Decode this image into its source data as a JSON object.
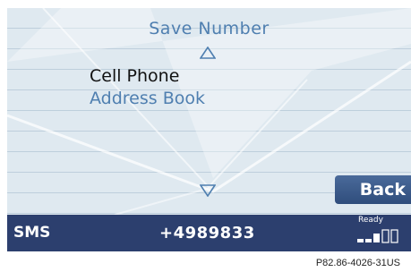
{
  "screen": {
    "title": "Save Number",
    "menu_items": [
      {
        "label": "Cell Phone",
        "selected": true
      },
      {
        "label": "Address Book",
        "selected": false
      }
    ],
    "back_label": "Back"
  },
  "status_bar": {
    "mode": "SMS",
    "phone_number": "+4989833",
    "status": "Ready",
    "signal_bars": 3,
    "signal_max": 5
  },
  "caption": "P82.86-4026-31US",
  "colors": {
    "accent_blue": "#4f7fb0",
    "status_bar": "#2c3f6e",
    "back_button": "#3a5a8a",
    "background": "#dfe9f0"
  },
  "icons": [
    "scroll-up-icon",
    "scroll-down-icon",
    "signal-strength-icon",
    "envelope-graphic"
  ]
}
